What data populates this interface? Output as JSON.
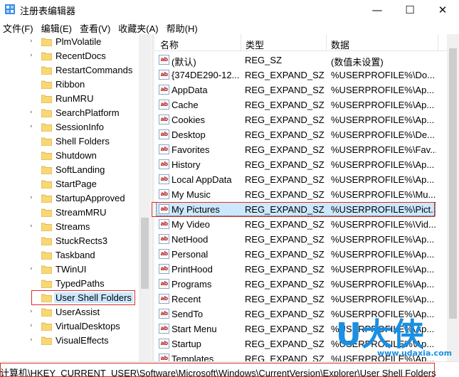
{
  "window": {
    "title": "注册表编辑器",
    "minimize_glyph": "—",
    "maximize_glyph": "☐",
    "close_glyph": "✕"
  },
  "menubar": [
    "文件(F)",
    "编辑(E)",
    "查看(V)",
    "收藏夹(A)",
    "帮助(H)"
  ],
  "tree": {
    "items": [
      {
        "label": "PlmVolatile",
        "expandable": true
      },
      {
        "label": "RecentDocs",
        "expandable": true
      },
      {
        "label": "RestartCommands",
        "expandable": false
      },
      {
        "label": "Ribbon",
        "expandable": false
      },
      {
        "label": "RunMRU",
        "expandable": false
      },
      {
        "label": "SearchPlatform",
        "expandable": true
      },
      {
        "label": "SessionInfo",
        "expandable": true
      },
      {
        "label": "Shell Folders",
        "expandable": false
      },
      {
        "label": "Shutdown",
        "expandable": false
      },
      {
        "label": "SoftLanding",
        "expandable": false
      },
      {
        "label": "StartPage",
        "expandable": false
      },
      {
        "label": "StartupApproved",
        "expandable": true
      },
      {
        "label": "StreamMRU",
        "expandable": false
      },
      {
        "label": "Streams",
        "expandable": true
      },
      {
        "label": "StuckRects3",
        "expandable": false
      },
      {
        "label": "Taskband",
        "expandable": false
      },
      {
        "label": "TWinUI",
        "expandable": true
      },
      {
        "label": "TypedPaths",
        "expandable": false
      },
      {
        "label": "User Shell Folders",
        "expandable": false,
        "selected": true
      },
      {
        "label": "UserAssist",
        "expandable": true
      },
      {
        "label": "VirtualDesktops",
        "expandable": true
      },
      {
        "label": "VisualEffects",
        "expandable": true
      }
    ],
    "expander_glyph": "›"
  },
  "list": {
    "columns": {
      "name": "名称",
      "type": "类型",
      "data": "数据"
    },
    "icon_text": "ab",
    "rows": [
      {
        "name": "(默认)",
        "type": "REG_SZ",
        "data": "(数值未设置)"
      },
      {
        "name": "{374DE290-12...",
        "type": "REG_EXPAND_SZ",
        "data": "%USERPROFILE%\\Do..."
      },
      {
        "name": "AppData",
        "type": "REG_EXPAND_SZ",
        "data": "%USERPROFILE%\\Ap..."
      },
      {
        "name": "Cache",
        "type": "REG_EXPAND_SZ",
        "data": "%USERPROFILE%\\Ap..."
      },
      {
        "name": "Cookies",
        "type": "REG_EXPAND_SZ",
        "data": "%USERPROFILE%\\Ap..."
      },
      {
        "name": "Desktop",
        "type": "REG_EXPAND_SZ",
        "data": "%USERPROFILE%\\De..."
      },
      {
        "name": "Favorites",
        "type": "REG_EXPAND_SZ",
        "data": "%USERPROFILE%\\Fav..."
      },
      {
        "name": "History",
        "type": "REG_EXPAND_SZ",
        "data": "%USERPROFILE%\\Ap..."
      },
      {
        "name": "Local AppData",
        "type": "REG_EXPAND_SZ",
        "data": "%USERPROFILE%\\Ap..."
      },
      {
        "name": "My Music",
        "type": "REG_EXPAND_SZ",
        "data": "%USERPROFILE%\\Mu..."
      },
      {
        "name": "My Pictures",
        "type": "REG_EXPAND_SZ",
        "data": "%USERPROFILE%\\Pict...",
        "selected": true
      },
      {
        "name": "My Video",
        "type": "REG_EXPAND_SZ",
        "data": "%USERPROFILE%\\Vid..."
      },
      {
        "name": "NetHood",
        "type": "REG_EXPAND_SZ",
        "data": "%USERPROFILE%\\Ap..."
      },
      {
        "name": "Personal",
        "type": "REG_EXPAND_SZ",
        "data": "%USERPROFILE%\\Ap..."
      },
      {
        "name": "PrintHood",
        "type": "REG_EXPAND_SZ",
        "data": "%USERPROFILE%\\Ap..."
      },
      {
        "name": "Programs",
        "type": "REG_EXPAND_SZ",
        "data": "%USERPROFILE%\\Ap..."
      },
      {
        "name": "Recent",
        "type": "REG_EXPAND_SZ",
        "data": "%USERPROFILE%\\Ap..."
      },
      {
        "name": "SendTo",
        "type": "REG_EXPAND_SZ",
        "data": "%USERPROFILE%\\Ap..."
      },
      {
        "name": "Start Menu",
        "type": "REG_EXPAND_SZ",
        "data": "%USERPROFILE%\\Ap..."
      },
      {
        "name": "Startup",
        "type": "REG_EXPAND_SZ",
        "data": "%USERPROFILE%\\Ap..."
      },
      {
        "name": "Templates",
        "type": "REG_EXPAND_SZ",
        "data": "%USERPROFILE%\\Ap..."
      }
    ]
  },
  "statusbar": {
    "path": "计算机\\HKEY_CURRENT_USER\\Software\\Microsoft\\Windows\\CurrentVersion\\Explorer\\User Shell Folders"
  },
  "watermark": {
    "letter": "U",
    "brand": "大侠",
    "url": "www.udaxia.com"
  },
  "colors": {
    "selection": "#cce8ff",
    "annotation_red": "#d9302a",
    "folder_yellow": "#f8d775",
    "watermark_blue": "#1a8fe3"
  }
}
